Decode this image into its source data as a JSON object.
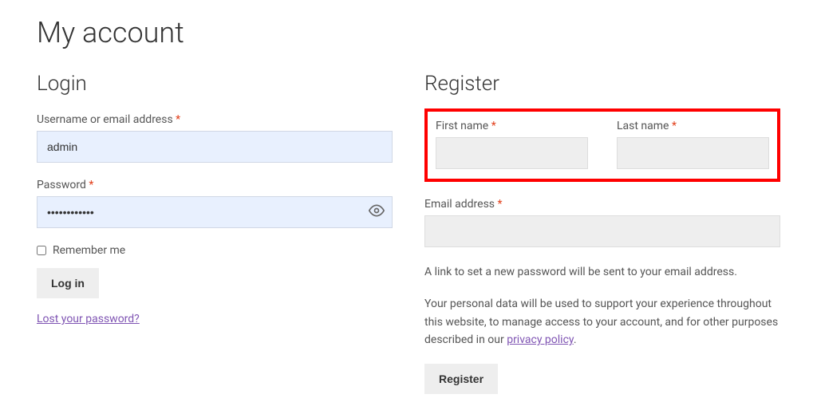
{
  "page_title": "My account",
  "login": {
    "heading": "Login",
    "username_label": "Username or email address ",
    "username_value": "admin",
    "password_label": "Password ",
    "password_value": "••••••••••••",
    "remember_label": "Remember me",
    "login_button": "Log in",
    "lost_password": "Lost your password?",
    "required_mark": "*"
  },
  "register": {
    "heading": "Register",
    "first_name_label": "First name ",
    "last_name_label": "Last name ",
    "email_label": "Email address ",
    "required_mark": "*",
    "password_hint": "A link to set a new password will be sent to your email address.",
    "privacy_text_1": "Your personal data will be used to support your experience throughout this website, to manage access to your account, and for other purposes described in our ",
    "privacy_link_text": "privacy policy",
    "privacy_text_2": ".",
    "register_button": "Register"
  }
}
